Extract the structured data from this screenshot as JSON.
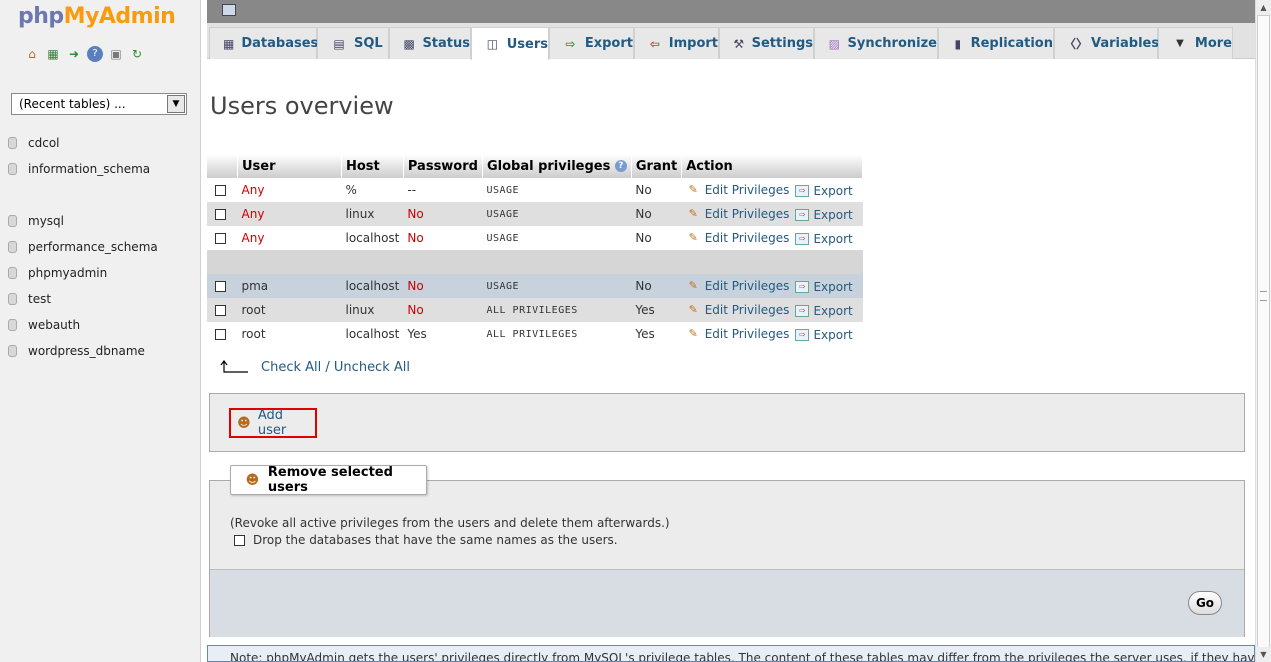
{
  "logo": {
    "part1": "php",
    "part2": "MyAdmin"
  },
  "nav": {
    "icons": [
      "home-icon",
      "database-icon",
      "exit-icon",
      "help-icon",
      "docs-icon",
      "reload-icon"
    ],
    "recent_tables": "(Recent tables) ...",
    "databases": [
      "cdcol",
      "information_schema",
      "mysql",
      "performance_schema",
      "phpmyadmin",
      "test",
      "webauth",
      "wordpress_dbname"
    ]
  },
  "tabs": [
    {
      "label": "Databases",
      "icon": "database-icon"
    },
    {
      "label": "SQL",
      "icon": "sql-icon"
    },
    {
      "label": "Status",
      "icon": "status-icon"
    },
    {
      "label": "Users",
      "icon": "users-icon"
    },
    {
      "label": "Export",
      "icon": "export-icon"
    },
    {
      "label": "Import",
      "icon": "import-icon"
    },
    {
      "label": "Settings",
      "icon": "settings-icon"
    },
    {
      "label": "Synchronize",
      "icon": "synchronize-icon"
    },
    {
      "label": "Replication",
      "icon": "replication-icon"
    },
    {
      "label": "Variables",
      "icon": "variables-icon"
    },
    {
      "label": "More",
      "icon": "chevron-down-icon"
    }
  ],
  "page_title": "Users overview",
  "table": {
    "headers": {
      "user": "User",
      "host": "Host",
      "password": "Password",
      "global_privileges": "Global privileges",
      "grant": "Grant",
      "action": "Action"
    },
    "edit_label": "Edit Privileges",
    "export_label": "Export",
    "rows": [
      {
        "user": "Any",
        "host": "%",
        "password": "--",
        "privileges": "USAGE",
        "grant": "No"
      },
      {
        "user": "Any",
        "host": "linux",
        "password": "No",
        "privileges": "USAGE",
        "grant": "No"
      },
      {
        "user": "Any",
        "host": "localhost",
        "password": "No",
        "privileges": "USAGE",
        "grant": "No"
      },
      {
        "user": "pma",
        "host": "localhost",
        "password": "No",
        "privileges": "USAGE",
        "grant": "No"
      },
      {
        "user": "root",
        "host": "linux",
        "password": "No",
        "privileges": "ALL PRIVILEGES",
        "grant": "Yes"
      },
      {
        "user": "root",
        "host": "localhost",
        "password": "Yes",
        "privileges": "ALL PRIVILEGES",
        "grant": "Yes"
      }
    ]
  },
  "check_all": "Check All",
  "check_sep": "/",
  "uncheck_all": "Uncheck All",
  "add_user": "Add user",
  "remove": {
    "legend": "Remove selected users",
    "description": "(Revoke all active privileges from the users and delete them afterwards.)",
    "drop_label": "Drop the databases that have the same names as the users.",
    "go": "Go"
  },
  "notice": "Note: phpMyAdmin gets the users' privileges directly from MySQL's privilege tables. The content of these tables may differ from the privileges the server uses, if they have"
}
